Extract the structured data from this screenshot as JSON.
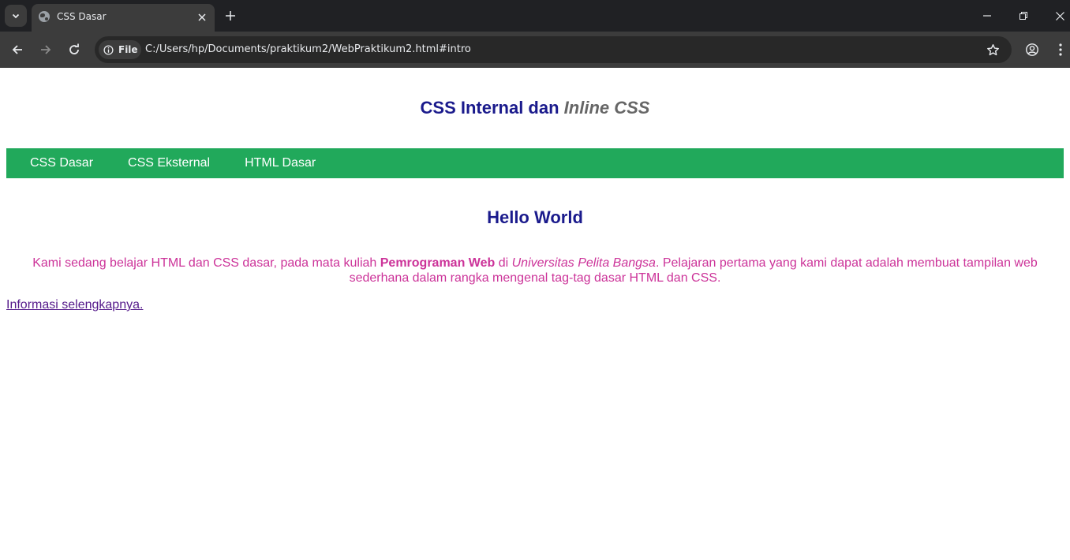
{
  "browser": {
    "tab_title": "CSS Dasar",
    "url_chip_label": "File",
    "url": "C:/Users/hp/Documents/praktikum2/WebPraktikum2.html#intro"
  },
  "page": {
    "title_part1": "CSS Internal dan ",
    "title_part2": "Inline CSS",
    "menu": [
      "CSS Dasar",
      "CSS Eksternal",
      "HTML Dasar"
    ],
    "heading": "Hello World",
    "intro": {
      "text1": "Kami sedang belajar HTML dan CSS dasar, pada mata kuliah ",
      "bold": "Pemrograman Web",
      "text2": " di ",
      "italic": "Universitas Pelita Bangsa",
      "text3": ". Pelajaran pertama yang kami dapat adalah membuat tampilan web sederhana dalam rangka mengenal tag-tag dasar HTML dan CSS."
    },
    "more_link": "Informasi selengkapnya."
  },
  "colors": {
    "menu_bg": "#21a95b",
    "title": "#1a1a8c",
    "intro_text": "#cc3399",
    "link_visited": "#551a8b"
  }
}
